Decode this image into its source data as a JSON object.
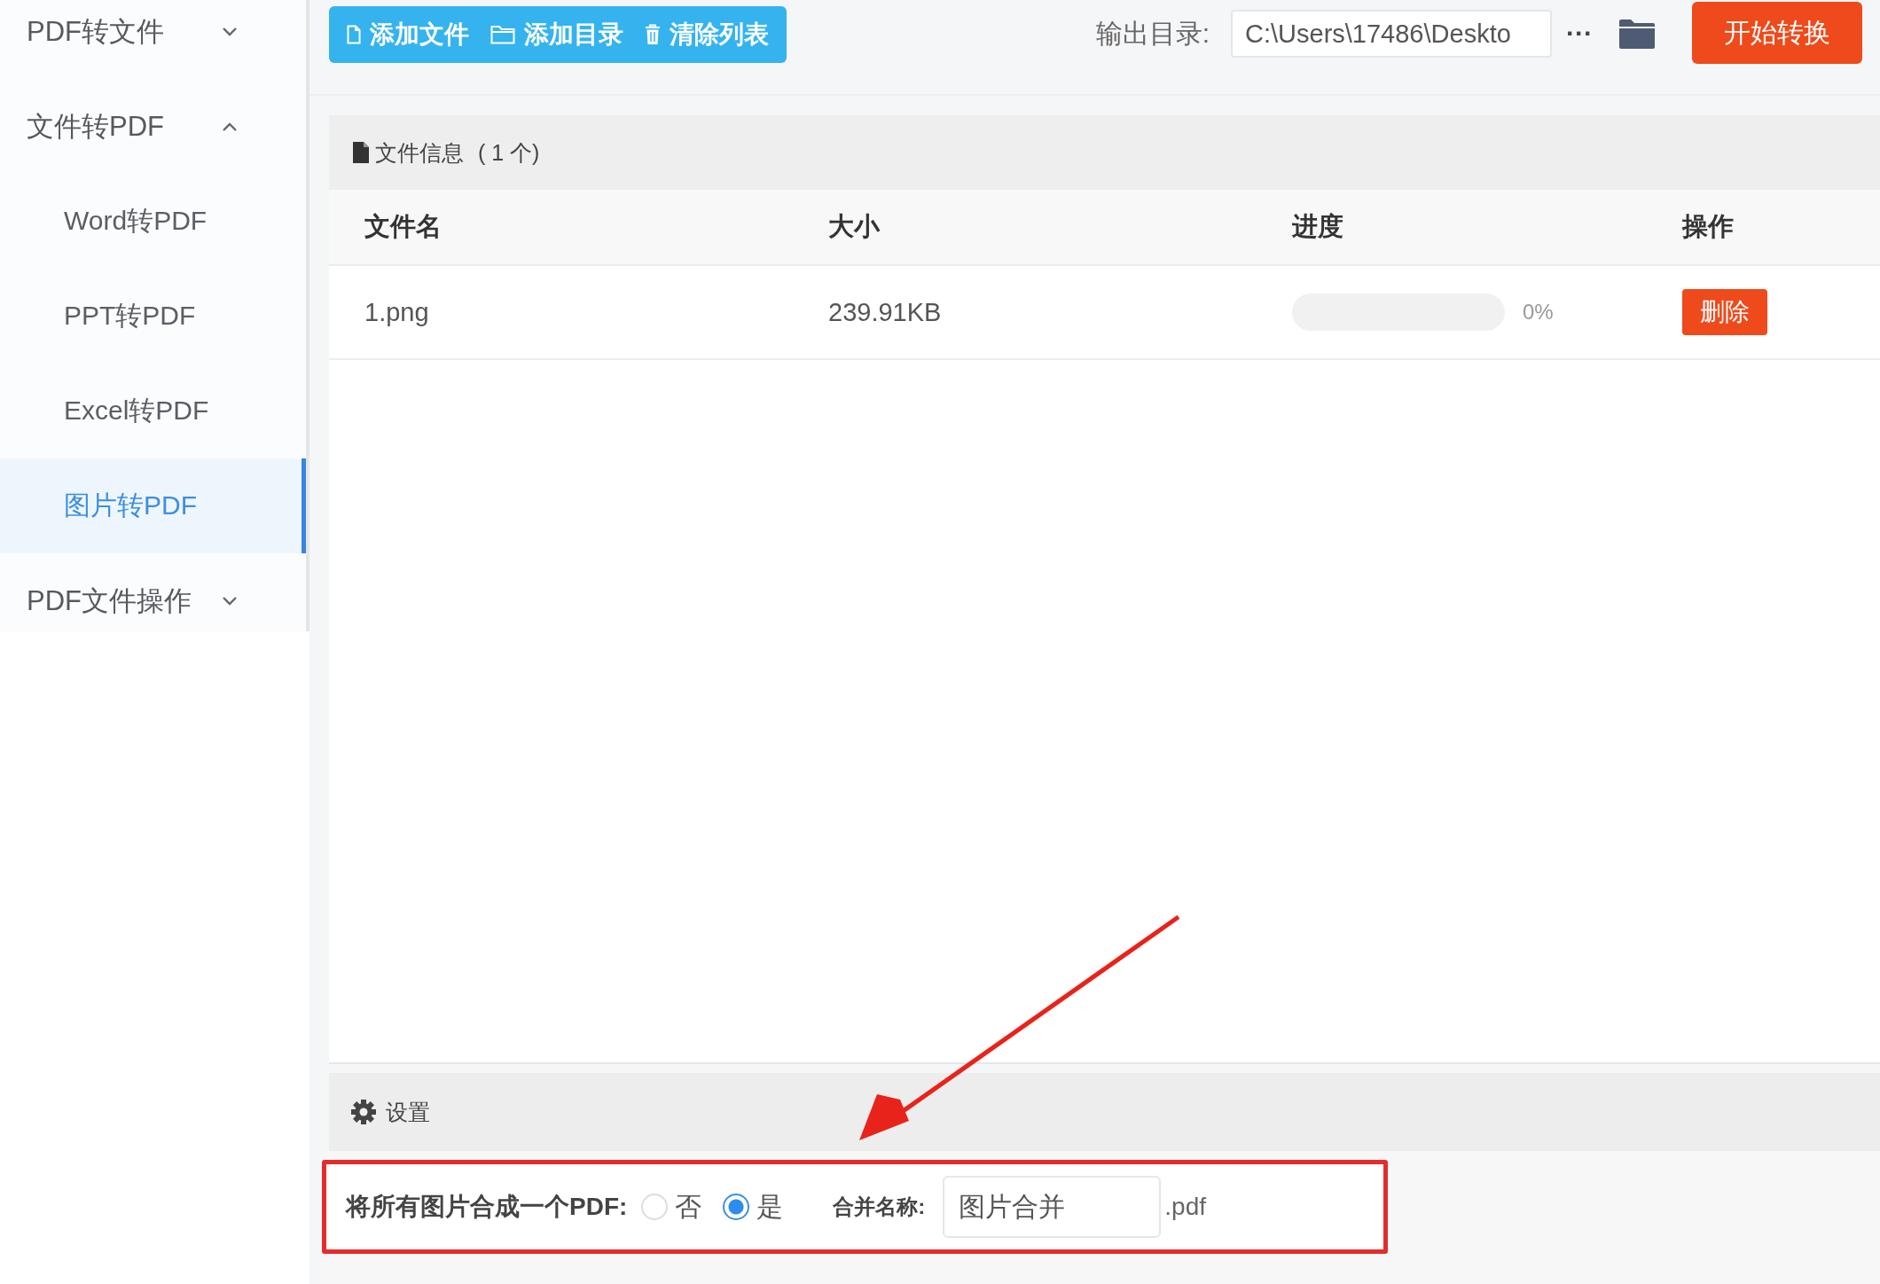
{
  "sidebar": {
    "items": [
      {
        "label": "PDF转文件",
        "expanded": false
      },
      {
        "label": "文件转PDF",
        "expanded": true,
        "children": [
          {
            "label": "Word转PDF",
            "selected": false
          },
          {
            "label": "PPT转PDF",
            "selected": false
          },
          {
            "label": "Excel转PDF",
            "selected": false
          },
          {
            "label": "图片转PDF",
            "selected": true
          }
        ]
      },
      {
        "label": "PDF文件操作",
        "expanded": false
      }
    ]
  },
  "toolbar": {
    "buttons": [
      {
        "kind": "file",
        "label": "添加文件"
      },
      {
        "kind": "folder",
        "label": "添加目录"
      },
      {
        "kind": "trash",
        "label": "清除列表"
      }
    ],
    "output_label": "输出目录:",
    "output_path": "C:\\Users\\17486\\Deskto",
    "more_button": "···",
    "start_button": "开始转换"
  },
  "file_panel": {
    "title": "文件信息",
    "count": "( 1 个)",
    "columns": [
      "文件名",
      "大小",
      "进度",
      "操作"
    ],
    "rows": [
      {
        "name": "1.png",
        "size": "239.91KB",
        "progress": {
          "level": 0,
          "reading": "0%"
        },
        "action": "删除"
      }
    ]
  },
  "settings": {
    "title": "设置",
    "option_label": "将所有图片合成一个PDF:",
    "radios": [
      {
        "label": "否",
        "selected": false
      },
      {
        "label": "是",
        "selected": true
      }
    ],
    "merge_label": "合并名称:",
    "merge_value": "图片合并",
    "suffix": ".pdf"
  }
}
